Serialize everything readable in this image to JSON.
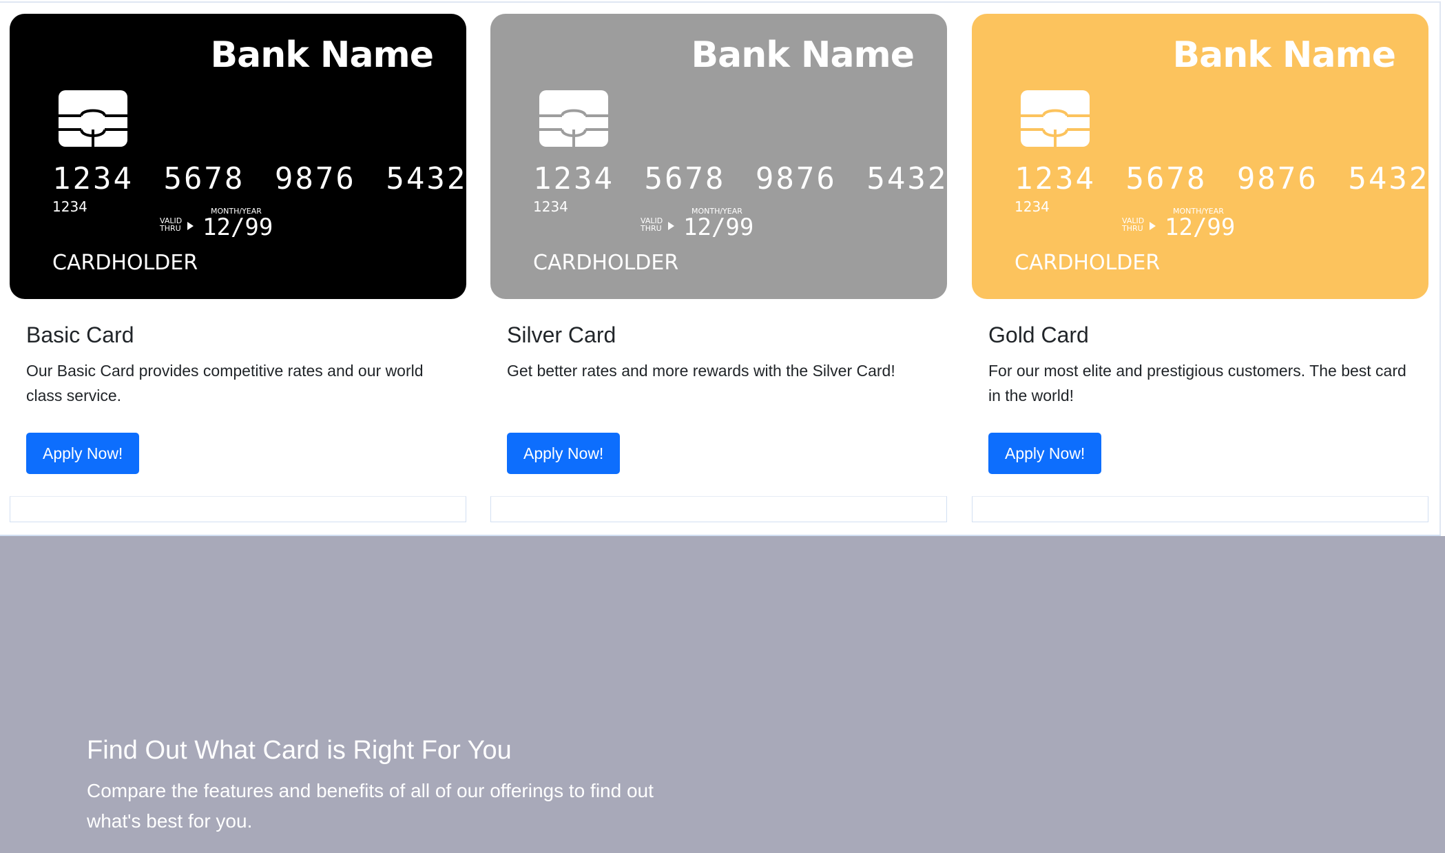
{
  "cards": [
    {
      "theme": "black",
      "bank_name": "Bank Name",
      "card_number": "1234 5678 9876 5432",
      "card_number_small": "1234",
      "valid_thru_line1": "VALID",
      "valid_thru_line2": "THRU",
      "month_year_label": "MONTH/YEAR",
      "expiry": "12/99",
      "cardholder": "CARDHOLDER",
      "title": "Basic Card",
      "description": "Our Basic Card provides competitive rates and our world class service.",
      "button_label": "Apply Now!"
    },
    {
      "theme": "silver",
      "bank_name": "Bank Name",
      "card_number": "1234 5678 9876 5432",
      "card_number_small": "1234",
      "valid_thru_line1": "VALID",
      "valid_thru_line2": "THRU",
      "month_year_label": "MONTH/YEAR",
      "expiry": "12/99",
      "cardholder": "CARDHOLDER",
      "title": "Silver Card",
      "description": "Get better rates and more rewards with the Silver Card!",
      "button_label": "Apply Now!"
    },
    {
      "theme": "gold",
      "bank_name": "Bank Name",
      "card_number": "1234 5678 9876 5432",
      "card_number_small": "1234",
      "valid_thru_line1": "VALID",
      "valid_thru_line2": "THRU",
      "month_year_label": "MONTH/YEAR",
      "expiry": "12/99",
      "cardholder": "CARDHOLDER",
      "title": "Gold Card",
      "description": "For our most elite and prestigious customers. The best card in the world!",
      "button_label": "Apply Now!"
    }
  ],
  "promo": {
    "title": "Find Out What Card is Right For You",
    "text": "Compare the features and benefits of all of our offerings to find out what's best for you."
  },
  "colors": {
    "button": "#0d6efd",
    "black_card": "#000000",
    "silver_card": "#9d9d9d",
    "gold_card": "#fcc35d",
    "promo_background": "#a8a9b9"
  },
  "icons": {
    "chip": "card-chip-icon",
    "arrow": "valid-thru-arrow-icon"
  }
}
